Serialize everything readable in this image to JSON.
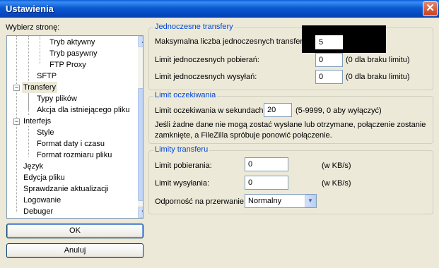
{
  "window": {
    "title": "Ustawienia",
    "close": "✕"
  },
  "sidebar": {
    "label": "Wybierz stronę:",
    "items": [
      "Tryb aktywny",
      "Tryb pasywny",
      "FTP Proxy",
      "SFTP",
      "Transfery",
      "Typy plików",
      "Akcja dla istniejącego pliku",
      "Interfejs",
      "Style",
      "Format daty i czasu",
      "Format rozmiaru pliku",
      "Język",
      "Edycja pliku",
      "Sprawdzanie aktualizacji",
      "Logowanie",
      "Debuger"
    ],
    "expanders": {
      "minus": "−"
    },
    "scroll": {
      "up": "▲",
      "down": "▼"
    }
  },
  "buttons": {
    "ok": "OK",
    "cancel": "Anuluj"
  },
  "concurrent": {
    "title": "Jednoczesne transfery",
    "max_label": "Maksymalna liczba jednoczesnych transferów:",
    "max_value": "5",
    "downloads_label": "Limit jednoczesnych pobierań:",
    "downloads_value": "0",
    "downloads_hint": "(0 dla braku limitu)",
    "uploads_label": "Limit jednoczesnych wysyłań:",
    "uploads_value": "0",
    "uploads_hint": "(0 dla braku limitu)"
  },
  "timeout": {
    "title": "Limit oczekiwania",
    "label": "Limit oczekiwania w sekundach:",
    "value": "20",
    "hint": "(5-9999, 0 aby wyłączyć)",
    "note_line1": "Jeśli żadne dane nie mogą zostać wysłane lub otrzymane, połączenie zostanie",
    "note_line2": "zamknięte, a FileZilla spróbuje ponowić połączenie."
  },
  "speed": {
    "title": "Limity transferu",
    "download_label": "Limit pobierania:",
    "download_value": "0",
    "download_unit": "(w KB/s)",
    "upload_label": "Limit wysyłania:",
    "upload_value": "0",
    "upload_unit": "(w KB/s)",
    "resilience_label": "Odporność na przerwanie",
    "resilience_value": "Normalny",
    "dropdown_arrow": "▼"
  },
  "colors": {
    "titlebar": "#0a5fd8",
    "group_title": "#0046d5",
    "dialog_bg": "#ece9d8"
  }
}
